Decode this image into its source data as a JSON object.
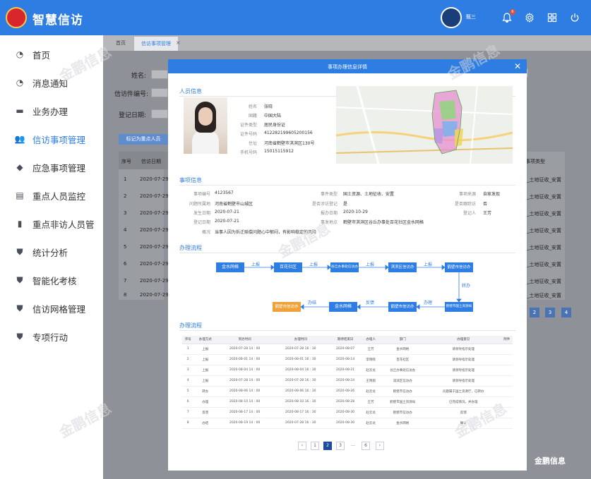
{
  "header": {
    "app_title": "智慧信访",
    "username": "甄三",
    "notification_count": "6"
  },
  "sidebar": {
    "items": [
      {
        "label": "首页",
        "icon": "dashboard-icon",
        "active": false
      },
      {
        "label": "消息通知",
        "icon": "message-icon",
        "active": false
      },
      {
        "label": "业务办理",
        "icon": "briefcase-icon",
        "active": false
      },
      {
        "label": "信访事项管理",
        "icon": "users-icon",
        "active": true
      },
      {
        "label": "应急事项管理",
        "icon": "cube-icon",
        "active": false
      },
      {
        "label": "重点人员监控",
        "icon": "document-icon",
        "active": false
      },
      {
        "label": "重点非访人员管",
        "icon": "bookmark-icon",
        "active": false
      },
      {
        "label": "统计分析",
        "icon": "shield-icon",
        "active": false
      },
      {
        "label": "智能化考核",
        "icon": "shield-icon",
        "active": false
      },
      {
        "label": "信访网格管理",
        "icon": "shield-icon",
        "active": false
      },
      {
        "label": "专项行动",
        "icon": "shield-icon",
        "active": false
      }
    ]
  },
  "tabs": {
    "crumb": "首页",
    "active_tab": "信访事项管理"
  },
  "filter": {
    "name_label": "姓名:",
    "petition_no_label": "信访件编号:",
    "date_label": "登记日期:",
    "mark_button": "标记为重点人员"
  },
  "bg_table": {
    "headers": [
      "序号",
      "信访日期"
    ],
    "right_header": "事项类型",
    "rows": [
      {
        "no": "1",
        "date": "2020-07-29",
        "type": "_土地征收_安置"
      },
      {
        "no": "2",
        "date": "2020-07-29",
        "type": "_土地征收_安置"
      },
      {
        "no": "3",
        "date": "2020-07-29",
        "type": "_土地征收_安置"
      },
      {
        "no": "4",
        "date": "2020-07-29",
        "type": "_土地征收_安置"
      },
      {
        "no": "5",
        "date": "2020-07-29",
        "type": "_土地征收_安置"
      },
      {
        "no": "6",
        "date": "2020-07-29",
        "type": "_土地征收_安置"
      },
      {
        "no": "7",
        "date": "2020-07-29",
        "type": "_土地征收_安置"
      },
      {
        "no": "8",
        "date": "2020-07-29",
        "type": "_土地征收_安置"
      }
    ],
    "pages": [
      "2",
      "3",
      "4"
    ]
  },
  "modal": {
    "title": "事项办理信息详情",
    "person_section": "人员信息",
    "person": [
      {
        "k": "姓名",
        "v": "张晓"
      },
      {
        "k": "国籍",
        "v": "中国大陆"
      },
      {
        "k": "证件类型",
        "v": "居民身份证"
      },
      {
        "k": "证件号码",
        "v": "412282199605200156"
      },
      {
        "k": "住址",
        "v": "河南省鹤壁市淇滨区130号"
      },
      {
        "k": "手机号码",
        "v": "15015115912"
      }
    ],
    "matter_section": "事项信息",
    "matter_rows": [
      [
        {
          "k": "事项编号",
          "v": "4123567"
        },
        {
          "k": "事件类型",
          "v": "国土资源、土地征收、安置"
        },
        {
          "k": "事项来源",
          "v": "自家发现"
        }
      ],
      [
        {
          "k": "问题所属地",
          "v": "河南省鹤壁市山城区"
        },
        {
          "k": "是否涉访登记",
          "v": "是"
        },
        {
          "k": "是否跟踪访",
          "v": "否"
        }
      ],
      [
        {
          "k": "发生日期",
          "v": "2020-07-21"
        },
        {
          "k": "报办日期",
          "v": "2020-10-29"
        },
        {
          "k": "登记人",
          "v": "王芳"
        }
      ],
      [
        {
          "k": "登记日期",
          "v": "2020-07-21"
        },
        {
          "k": "事发地点",
          "v": "鹤壁市淇滨区谷丘办事处百花社区金水网格"
        }
      ]
    ],
    "summary": {
      "k": "概况",
      "v": "当事人因为拆迁赔偿问题心中郁闷，有影响稳定的风险"
    },
    "flow_section": "办理流程",
    "flow_nodes": [
      "金水网格",
      "百花社区",
      "谷丘办事处信访办",
      "淇滨区信访办",
      "鹤壁市信访办",
      "鹤壁市国土资源局",
      "鹤壁市信访办",
      "金水网格",
      "鹤壁市信访办"
    ],
    "flow_actions": [
      "上报",
      "上报",
      "上报",
      "上报",
      "转办",
      "办理",
      "反馈",
      "办结"
    ],
    "proc_section": "办理流程",
    "proc_headers": [
      "序号",
      "办理方式",
      "到达时间",
      "办理时间",
      "期待结束日",
      "办理人",
      "部门",
      "办理意见",
      "附件"
    ],
    "proc_rows": [
      [
        "1",
        "上报",
        "2020-07-28 14 : 00",
        "2020-07-28 16 : 30",
        "2020-08-07",
        "王芳",
        "金水网格",
        "请领导指示处理",
        ""
      ],
      [
        "2",
        "上报",
        "2020-08-01 14 : 00",
        "2020-08-01 16 : 30",
        "2020-08-14",
        "李晓晓",
        "百花社区",
        "请领导指示处理",
        ""
      ],
      [
        "3",
        "上报",
        "2020-08-04 14 : 00",
        "2020-08-04 16 : 30",
        "2020-08-21",
        "赵云龙",
        "谷丘办事处信访办",
        "请领导指示处理",
        ""
      ],
      [
        "4",
        "上报",
        "2020-07-28 14 : 00",
        "2020-07-28 16 : 30",
        "2020-08-24",
        "王晓丽",
        "淇滨区信访办",
        "请领导指示处理",
        ""
      ],
      [
        "5",
        "转办",
        "2020-08-06 14 : 00",
        "2020-08-06 16 : 30",
        "2020-08-26",
        "赵云龙",
        "鹤壁市信访办",
        "问题属于国土资源厅，已转办",
        ""
      ],
      [
        "6",
        "办理",
        "2020-08-10 14 : 00",
        "2020-08-10 16 : 30",
        "2020-08-28",
        "王芳",
        "鹤壁市国土资源局",
        "已完成情况，并办理",
        ""
      ],
      [
        "7",
        "反馈",
        "2020-08-17 14 : 00",
        "2020-08-17 16 : 30",
        "2020-08-30",
        "赵云龙",
        "鹤壁市信访办",
        "反馈",
        ""
      ],
      [
        "8",
        "办结",
        "2020-08-19 14 : 00",
        "2020-07-28 16 : 30",
        "2020-08-30",
        "赵云龙",
        "金水网格",
        "确认",
        ""
      ]
    ],
    "pager": [
      "‹",
      "1",
      "2",
      "3",
      "…",
      "6",
      "›"
    ]
  },
  "watermark": {
    "text": "金鹏信息",
    "sub": "GOLDPENG INFORMATION",
    "bottom_text": "金鹏信息"
  },
  "colors": {
    "primary": "#2d7de2",
    "orange": "#f0a23a",
    "sidebar_bg": "#ffffff"
  }
}
